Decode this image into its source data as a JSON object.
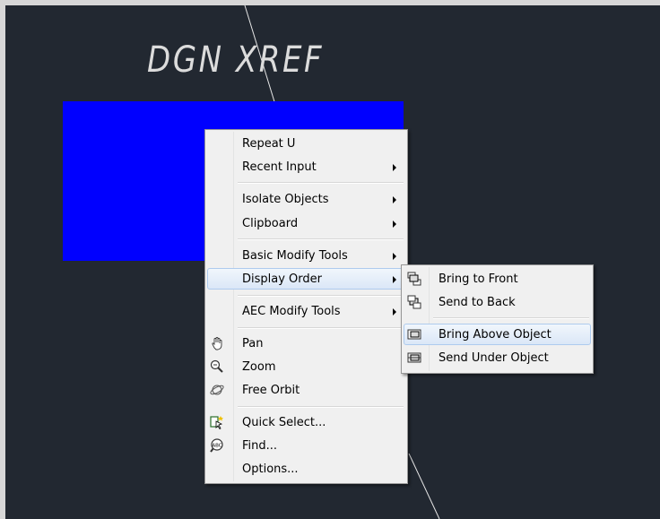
{
  "drawing": {
    "label": "DGN XREF",
    "rect_color": "#0000ff",
    "background_color": "#222831"
  },
  "context_menu": {
    "items": [
      {
        "label": "Repeat U",
        "submenu": false
      },
      {
        "label": "Recent Input",
        "submenu": true
      },
      {
        "label": "Isolate Objects",
        "submenu": true
      },
      {
        "label": "Clipboard",
        "submenu": true
      },
      {
        "label": "Basic Modify Tools",
        "submenu": true
      },
      {
        "label": "Display Order",
        "submenu": true,
        "active": true
      },
      {
        "label": "AEC Modify Tools",
        "submenu": true
      },
      {
        "label": "Pan",
        "icon": "pan-hand-icon"
      },
      {
        "label": "Zoom",
        "icon": "zoom-icon"
      },
      {
        "label": "Free Orbit",
        "icon": "free-orbit-icon"
      },
      {
        "label": "Quick Select...",
        "icon": "quick-select-icon"
      },
      {
        "label": "Find...",
        "icon": "find-text-icon"
      },
      {
        "label": "Options..."
      }
    ]
  },
  "display_order_submenu": {
    "items": [
      {
        "label": "Bring to Front",
        "icon": "bring-to-front-icon"
      },
      {
        "label": "Send to Back",
        "icon": "send-to-back-icon"
      },
      {
        "label": "Bring Above Object",
        "icon": "bring-above-icon",
        "hovered": true
      },
      {
        "label": "Send Under Object",
        "icon": "send-under-icon"
      }
    ]
  }
}
